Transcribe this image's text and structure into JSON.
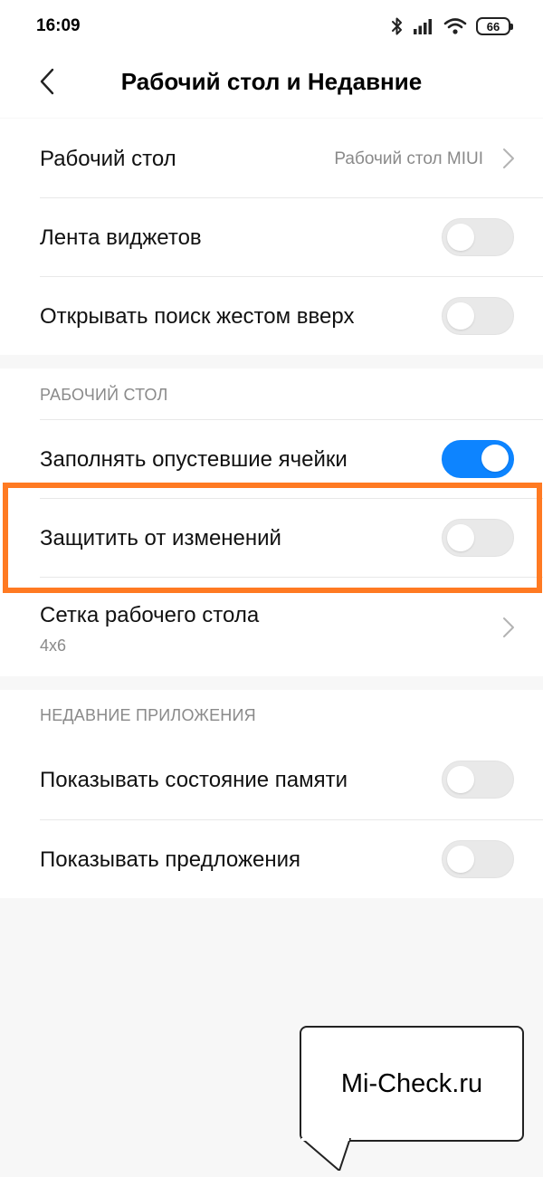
{
  "status_bar": {
    "time": "16:09",
    "battery": "66",
    "icons": [
      "bluetooth-icon",
      "signal-icon",
      "wifi-icon",
      "battery-icon"
    ]
  },
  "header": {
    "title": "Рабочий стол и Недавние",
    "back_icon": "chevron-left-icon"
  },
  "general": {
    "items": [
      {
        "label": "Рабочий стол",
        "value": "Рабочий стол MIUI",
        "type": "link"
      },
      {
        "label": "Лента виджетов",
        "type": "toggle",
        "on": false
      },
      {
        "label": "Открывать поиск жестом вверх",
        "type": "toggle",
        "on": false
      }
    ]
  },
  "desktop": {
    "header": "РАБОЧИЙ СТОЛ",
    "items": [
      {
        "label": "Заполнять опустевшие ячейки",
        "type": "toggle",
        "on": true
      },
      {
        "label": "Защитить от изменений",
        "type": "toggle",
        "on": false
      },
      {
        "label": "Сетка рабочего стола",
        "value": "4x6",
        "type": "link"
      }
    ]
  },
  "recent": {
    "header": "НЕДАВНИЕ ПРИЛОЖЕНИЯ",
    "items": [
      {
        "label": "Показывать состояние памяти",
        "type": "toggle",
        "on": false
      },
      {
        "label": "Показывать предложения",
        "type": "toggle",
        "on": false
      }
    ]
  },
  "watermark": {
    "text": "Mi-Check.ru"
  },
  "colors": {
    "toggle_on": "#0d84ff",
    "toggle_off": "#e9e9e9",
    "highlight": "#ff7a22",
    "background": "#f7f7f7"
  }
}
